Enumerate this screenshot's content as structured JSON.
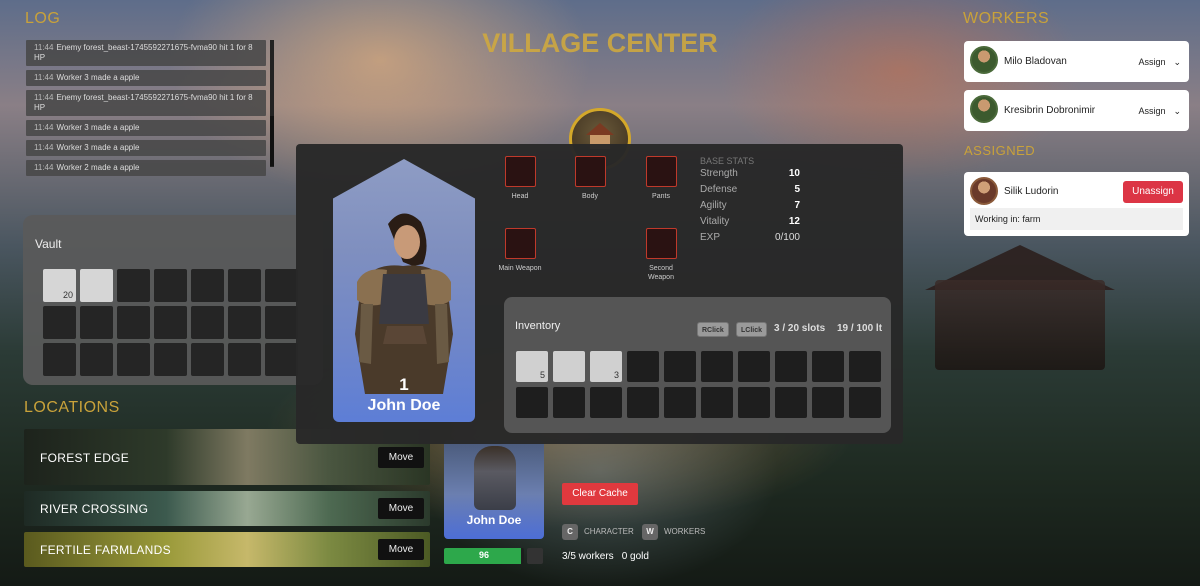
{
  "log": {
    "title": "LOG",
    "entries": [
      {
        "time": "11:44",
        "text": "Enemy forest_beast-1745592271675-fvma90 hit 1 for 8 HP"
      },
      {
        "time": "11:44",
        "text": "Worker 3 made a apple"
      },
      {
        "time": "11:44",
        "text": "Enemy forest_beast-1745592271675-fvma90 hit 1 for 8 HP"
      },
      {
        "time": "11:44",
        "text": "Worker 3 made a apple"
      },
      {
        "time": "11:44",
        "text": "Worker 3 made a apple"
      },
      {
        "time": "11:44",
        "text": "Worker 2 made a apple"
      }
    ]
  },
  "village": {
    "title": "VILLAGE CENTER",
    "icon": "village-house-icon"
  },
  "vault": {
    "title": "Vault",
    "slots": [
      {
        "filled": true,
        "qty": "20"
      },
      {
        "filled": true,
        "qty": ""
      },
      {
        "filled": false
      },
      {
        "filled": false
      },
      {
        "filled": false
      },
      {
        "filled": false
      },
      {
        "filled": false
      },
      {
        "filled": false
      },
      {
        "filled": false
      },
      {
        "filled": false
      },
      {
        "filled": false
      },
      {
        "filled": false
      },
      {
        "filled": false
      },
      {
        "filled": false
      },
      {
        "filled": false
      },
      {
        "filled": false
      },
      {
        "filled": false
      },
      {
        "filled": false
      },
      {
        "filled": false
      },
      {
        "filled": false
      },
      {
        "filled": false
      }
    ]
  },
  "locations": {
    "title": "LOCATIONS",
    "items": [
      {
        "name": "FOREST EDGE",
        "move_label": "Move"
      },
      {
        "name": "RIVER CROSSING",
        "move_label": "Move"
      },
      {
        "name": "FERTILE FARMLANDS",
        "move_label": "Move"
      }
    ]
  },
  "workers": {
    "title": "WORKERS",
    "items": [
      {
        "name": "Milo Bladovan",
        "action": "Assign"
      },
      {
        "name": "Kresibrin Dobronimir",
        "action": "Assign"
      }
    ]
  },
  "assigned": {
    "title": "ASSIGNED",
    "items": [
      {
        "name": "Silik Ludorin",
        "action": "Unassign",
        "status": "Working in: farm"
      }
    ]
  },
  "character": {
    "name": "John Doe",
    "level": "1",
    "hp": "96",
    "hp_fraction": 0.96,
    "clear_cache_label": "Clear Cache",
    "hotkeys": [
      {
        "key": "C",
        "label": "CHARACTER"
      },
      {
        "key": "W",
        "label": "WORKERS"
      }
    ],
    "workers_count": "3/5 workers",
    "gold": "0 gold"
  },
  "modal": {
    "equipment": {
      "head": "Head",
      "body": "Body",
      "pants": "Pants",
      "main_weapon": "Main Weapon",
      "second_weapon": "Second Weapon"
    },
    "base_stats": {
      "title": "BASE STATS",
      "rows": [
        {
          "name": "Strength",
          "value": "10"
        },
        {
          "name": "Defense",
          "value": "5"
        },
        {
          "name": "Agility",
          "value": "7"
        },
        {
          "name": "Vitality",
          "value": "12"
        },
        {
          "name": "EXP",
          "value": "0/100"
        }
      ]
    },
    "inventory": {
      "title": "Inventory",
      "rclick": "RClick",
      "lclick": "LClick",
      "slots_text": "3 / 20 slots",
      "weight_text": "19 / 100 lt",
      "slots": [
        {
          "filled": true,
          "qty": "5"
        },
        {
          "filled": true,
          "qty": ""
        },
        {
          "filled": true,
          "qty": "3"
        },
        {
          "filled": false
        },
        {
          "filled": false
        },
        {
          "filled": false
        },
        {
          "filled": false
        },
        {
          "filled": false
        },
        {
          "filled": false
        },
        {
          "filled": false
        },
        {
          "filled": false
        },
        {
          "filled": false
        },
        {
          "filled": false
        },
        {
          "filled": false
        },
        {
          "filled": false
        },
        {
          "filled": false
        },
        {
          "filled": false
        },
        {
          "filled": false
        },
        {
          "filled": false
        },
        {
          "filled": false
        }
      ]
    }
  }
}
